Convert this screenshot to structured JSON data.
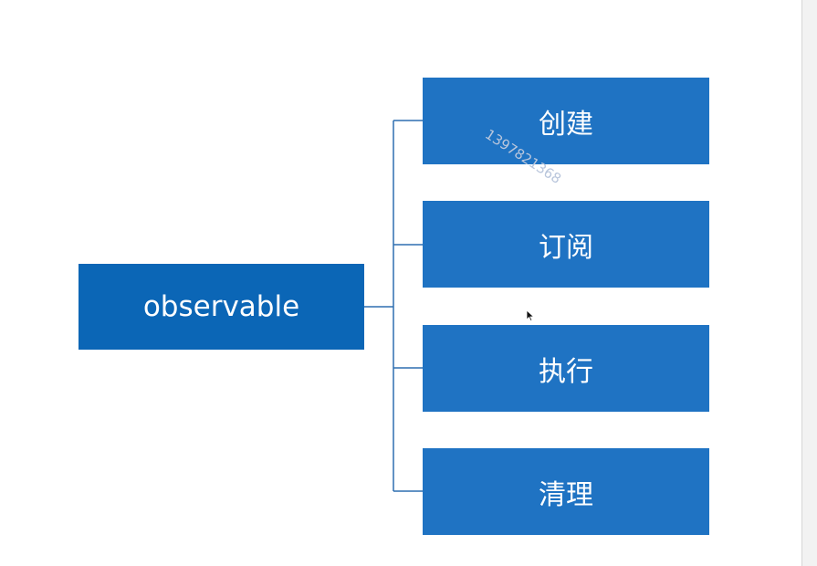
{
  "diagram": {
    "root": {
      "label": "observable"
    },
    "children": [
      {
        "label": "创建"
      },
      {
        "label": "订阅"
      },
      {
        "label": "执行"
      },
      {
        "label": "清理"
      }
    ]
  },
  "watermark": {
    "text": "13978213​68"
  },
  "colors": {
    "root_fill": "#0b66b6",
    "child_fill": "#1f73c3",
    "connector": "#2e6fb0",
    "text": "#ffffff"
  }
}
